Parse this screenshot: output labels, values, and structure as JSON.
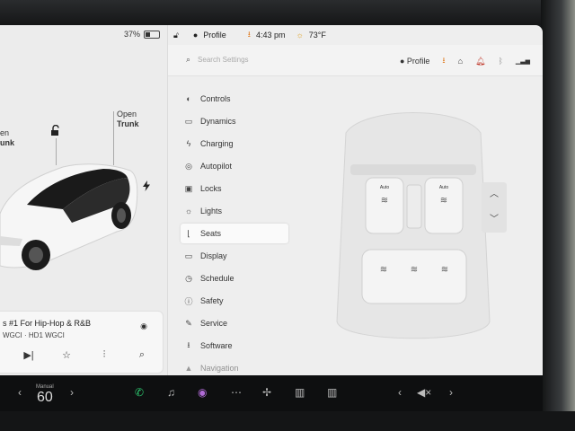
{
  "battery": {
    "percent_label": "37%",
    "level": 0.37
  },
  "car_panel": {
    "frunk_label": [
      "en",
      "unk"
    ],
    "trunk_label": [
      "Open",
      "Trunk"
    ]
  },
  "media": {
    "song": "s #1 For Hip-Hop & R&B",
    "station": "WGCI · HD1 WGCI"
  },
  "statusbar": {
    "profile": "Profile",
    "time": "4:43 pm",
    "temp": "73°F"
  },
  "settings": {
    "search_placeholder": "Search Settings",
    "profile": "Profile"
  },
  "menu": {
    "items": [
      {
        "label": "Controls",
        "icon": "toggle-icon"
      },
      {
        "label": "Dynamics",
        "icon": "car-icon"
      },
      {
        "label": "Charging",
        "icon": "bolt-icon"
      },
      {
        "label": "Autopilot",
        "icon": "steering-wheel-icon"
      },
      {
        "label": "Locks",
        "icon": "lock-icon"
      },
      {
        "label": "Lights",
        "icon": "sun-icon"
      },
      {
        "label": "Seats",
        "icon": "seat-icon"
      },
      {
        "label": "Display",
        "icon": "display-icon"
      },
      {
        "label": "Schedule",
        "icon": "clock-icon"
      },
      {
        "label": "Safety",
        "icon": "info-icon"
      },
      {
        "label": "Service",
        "icon": "wrench-icon"
      },
      {
        "label": "Software",
        "icon": "download-icon"
      },
      {
        "label": "Navigation",
        "icon": "navigation-icon"
      }
    ],
    "active": "Seats"
  },
  "seats": {
    "auto_left": "Auto",
    "auto_right": "Auto"
  },
  "dock": {
    "speed_mode": "Manual",
    "speed": "60"
  }
}
